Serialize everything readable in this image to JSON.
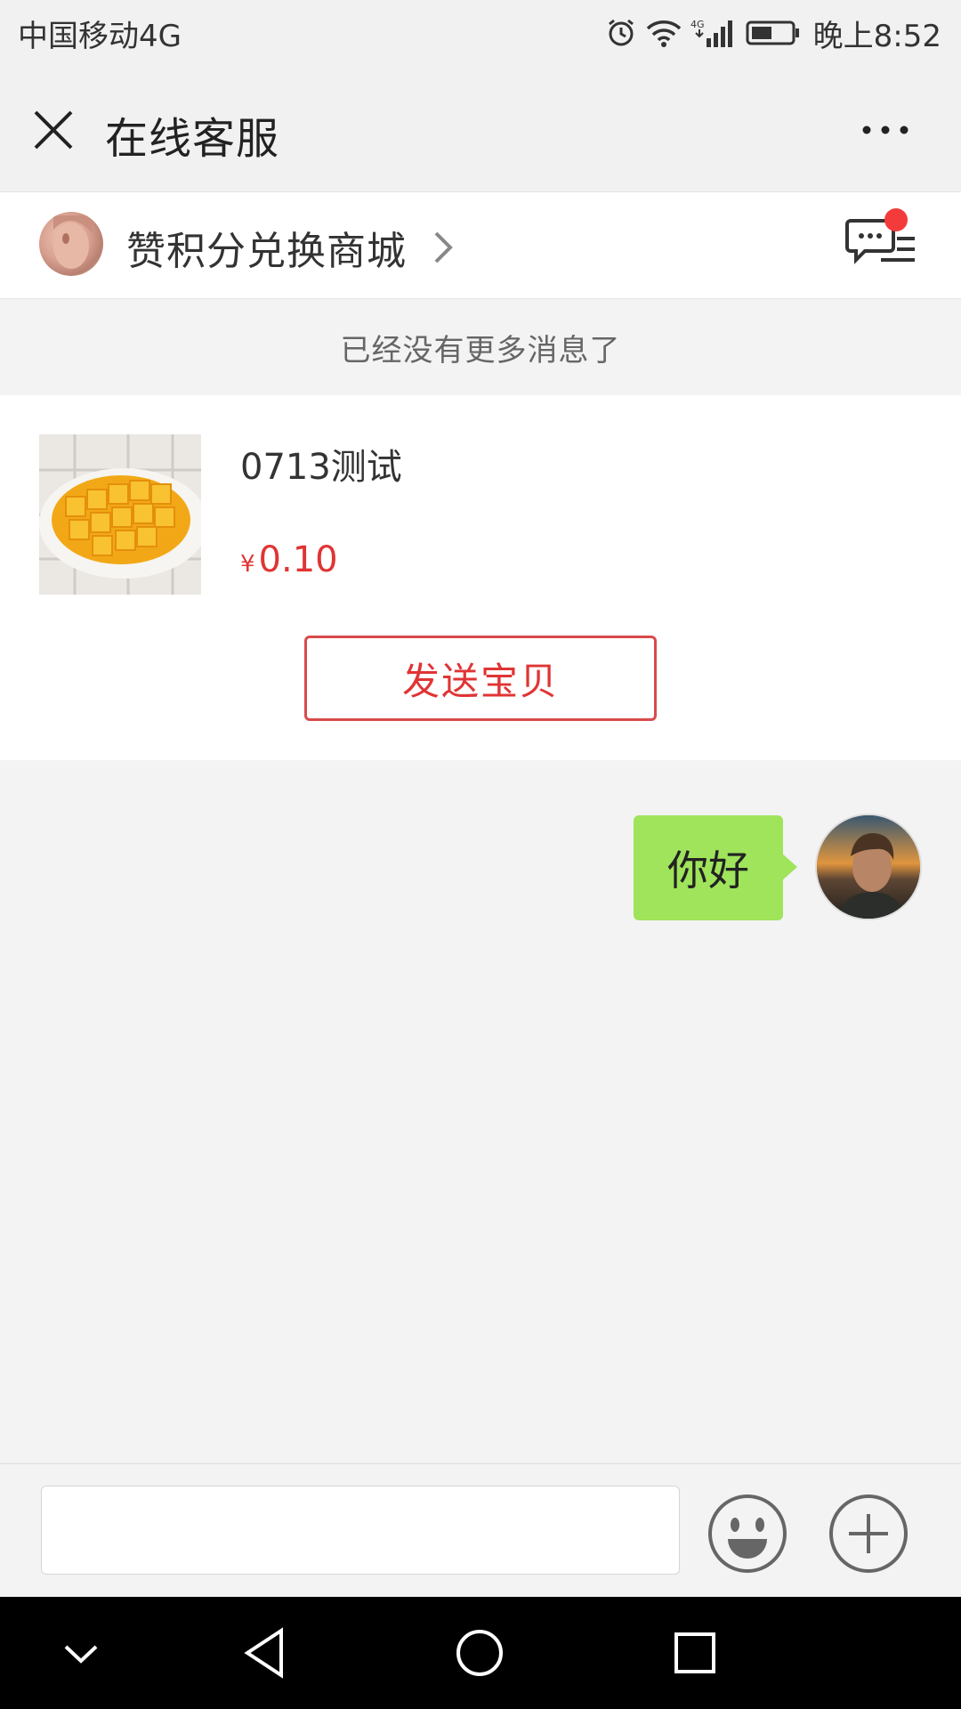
{
  "status_bar": {
    "carrier": "中国移动4G",
    "time": "晚上8:52",
    "icons": [
      "alarm-icon",
      "wifi-icon",
      "signal-4g-icon",
      "battery-icon"
    ]
  },
  "header": {
    "title": "在线客服",
    "close_icon": "close-icon",
    "more_icon": "more-icon"
  },
  "shop": {
    "name": "赞积分兑换商城",
    "message_icon": "chat-list-icon",
    "has_unread": true,
    "unread_color": "#f43b3b"
  },
  "chat": {
    "no_more_text": "已经没有更多消息了",
    "product": {
      "title": "0713测试",
      "currency": "¥",
      "price": "0.10",
      "send_button": "发送宝贝"
    },
    "messages": [
      {
        "from": "user",
        "text": "你好",
        "bubble_color": "#9fe45b"
      }
    ]
  },
  "input": {
    "value": "",
    "placeholder": "",
    "emoji_icon": "emoji-icon",
    "plus_icon": "plus-icon"
  },
  "nav_bar": {
    "icons": [
      "down-chevron-icon",
      "back-icon",
      "home-icon",
      "recents-icon"
    ]
  },
  "colors": {
    "accent_red": "#e03434",
    "bubble_green": "#9fe45b",
    "background": "#f3f3f4"
  }
}
